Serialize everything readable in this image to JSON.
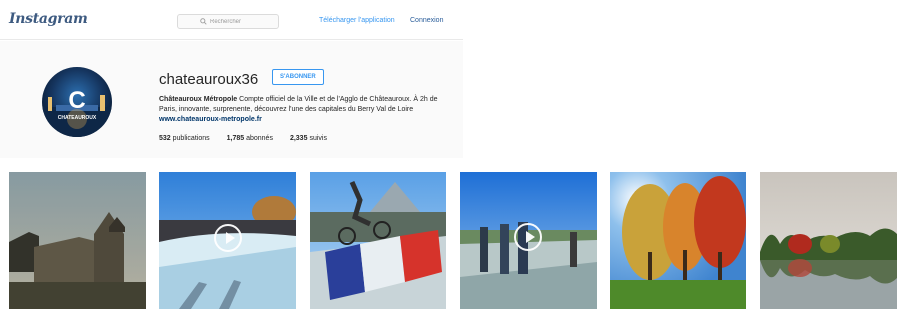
{
  "header": {
    "logo": "Instagram",
    "search": {
      "placeholder": "Rechercher"
    },
    "links": {
      "download_app": "Télécharger l'application",
      "login": "Connexion"
    }
  },
  "profile": {
    "username": "chateauroux36",
    "follow_label": "S'ABONNER",
    "avatar_letter": "C",
    "avatar_caption": "CHATEAUROUX",
    "bio": {
      "name": "Châteauroux Métropole",
      "text": " Compte officiel de la Ville et de l'Agglo de Châteauroux. À 2h de Paris, innovante, surprenente, découvrez l'une des capitales du Berry Val de Loire ",
      "url": "www.chateauroux-metropole.fr"
    },
    "stats": {
      "posts_count": "532",
      "posts_label": "publications",
      "followers_count": "1,785",
      "followers_label": "abonnés",
      "following_count": "2,335",
      "following_label": "suivis"
    }
  },
  "photos": [
    {
      "subject": "chateau-building",
      "video": false
    },
    {
      "subject": "skatepark-crowd",
      "video": true
    },
    {
      "subject": "bmx-rider-flag",
      "video": false
    },
    {
      "subject": "skatepark-people",
      "video": true
    },
    {
      "subject": "autumn-trees",
      "video": false
    },
    {
      "subject": "lake-reflection",
      "video": false
    }
  ],
  "colors": {
    "link_blue": "#3897f0",
    "logo_blue": "#3d5a80",
    "bio_link": "#003569"
  }
}
